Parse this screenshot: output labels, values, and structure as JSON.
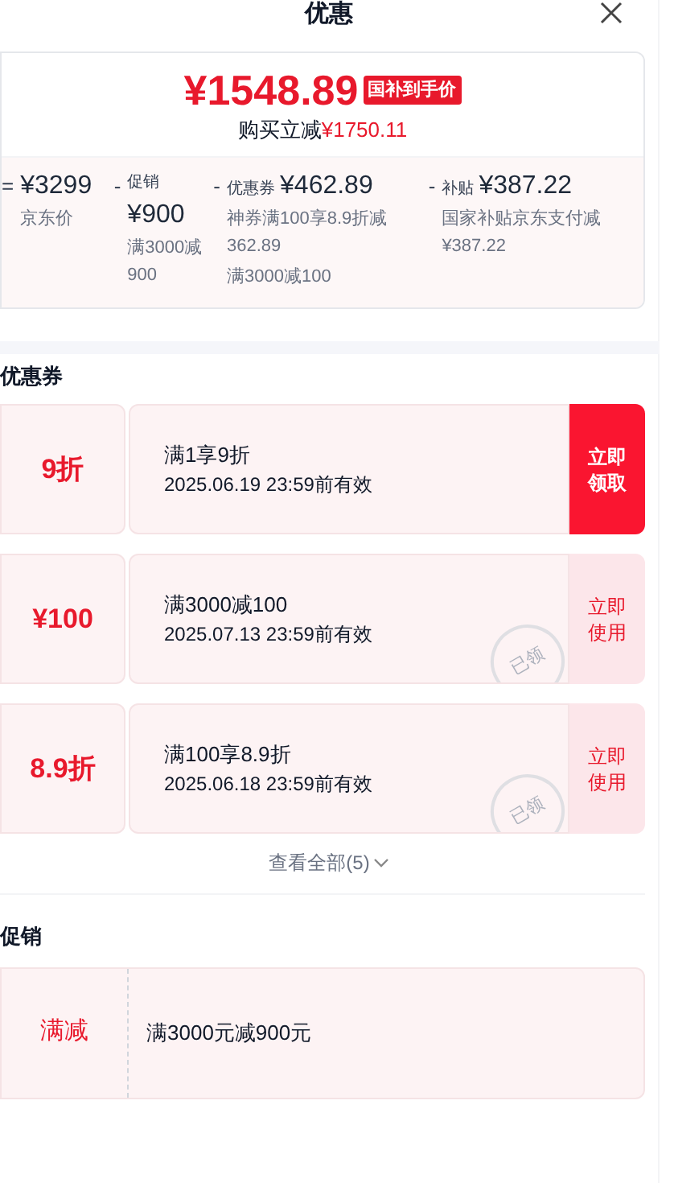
{
  "header": {
    "title": "优惠"
  },
  "price_card": {
    "price": "¥1548.89",
    "badge": "国补到手价",
    "saving_label": "购买立减",
    "saving": "¥1750.11",
    "breakdown": [
      {
        "op": "=",
        "amount": "¥3299",
        "notes": [
          "京东价"
        ]
      },
      {
        "op": "-",
        "label": "促销",
        "amount": "¥900",
        "notes": [
          "满3000减900"
        ]
      },
      {
        "op": "-",
        "label": "优惠券",
        "amount": "¥462.89",
        "notes": [
          "神券满100享8.9折减362.89",
          "满3000减100"
        ]
      },
      {
        "op": "-",
        "label": "补贴",
        "amount": "¥387.22",
        "notes": [
          "国家补贴京东支付减¥387.22"
        ]
      }
    ]
  },
  "coupons": {
    "heading": "优惠券",
    "items": [
      {
        "value": "9折",
        "title": "满1享9折",
        "validity": "2025.06.19 23:59前有效",
        "action": "立即领取",
        "claimed": false
      },
      {
        "value": "¥100",
        "title": "满3000减100",
        "validity": "2025.07.13 23:59前有效",
        "action": "立即使用",
        "claimed": true,
        "stamp": "已领"
      },
      {
        "value": "8.9折",
        "title": "满100享8.9折",
        "validity": "2025.06.18 23:59前有效",
        "action": "立即使用",
        "claimed": true,
        "stamp": "已领"
      }
    ],
    "view_all": "查看全部(5)"
  },
  "promotions": {
    "heading": "促销",
    "items": [
      {
        "type": "满减",
        "text": "满3000元减900元"
      }
    ]
  }
}
